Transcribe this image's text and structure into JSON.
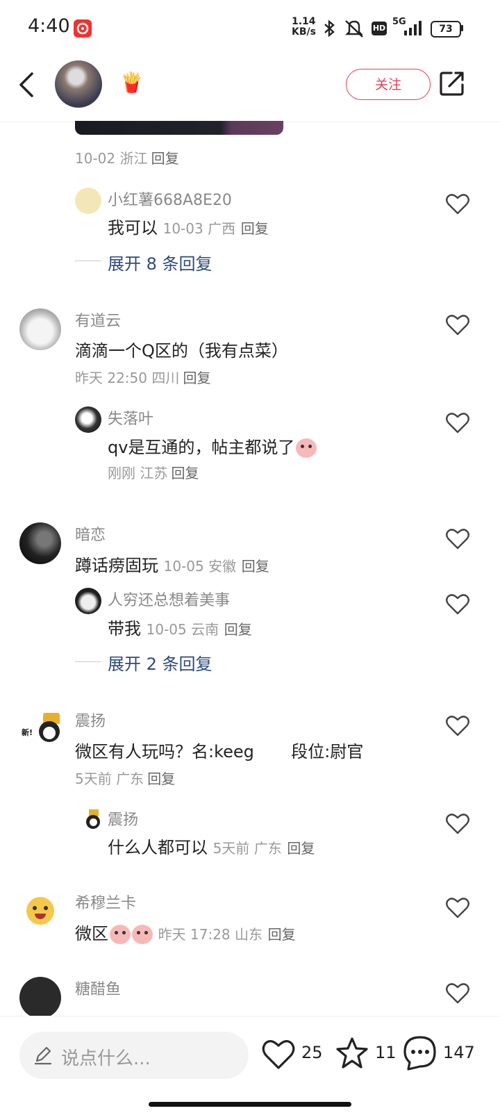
{
  "status_bar": {
    "time": "4:40",
    "network_speed_value": "1.14",
    "network_speed_unit": "KB/s",
    "hd": "HD",
    "network_type": "5G",
    "battery": "73"
  },
  "header": {
    "follow_label": "关注",
    "emoji": "🍟"
  },
  "comments": {
    "c0": {
      "meta": "10-02 浙江",
      "reply": "回复"
    },
    "c0r1": {
      "name": "小红薯668A8E20",
      "text": "我可以",
      "meta": "10-03 广西",
      "reply": "回复"
    },
    "c0_expand": "展开 8 条回复",
    "c1": {
      "name": "有道云",
      "text": "滴滴一个Q区的（我有点菜）",
      "meta": "昨天 22:50 四川",
      "reply": "回复"
    },
    "c1r1": {
      "name": "失落叶",
      "text": "qv是互通的，帖主都说了",
      "meta": "刚刚  江苏",
      "reply": "回复"
    },
    "c2": {
      "name": "暗恋",
      "text": "蹲话痨固玩",
      "meta": "10-05 安徽",
      "reply": "回复"
    },
    "c2r1": {
      "name": "人穷还总想着美事",
      "text": "带我",
      "meta": "10-05 云南",
      "reply": "回复"
    },
    "c2_expand": "展开 2 条回复",
    "c3": {
      "name": "震扬",
      "text": "微区有人玩吗？名:keeg       段位:尉官",
      "meta": "5天前  广东",
      "reply": "回复",
      "avatar_text": "新!"
    },
    "c3r1": {
      "name": "震扬",
      "text": "什么人都可以",
      "meta": "5天前  广东",
      "reply": "回复"
    },
    "c4": {
      "name": "希穆兰卡",
      "text": "微区",
      "meta": "昨天 17:28 山东",
      "reply": "回复"
    },
    "c5": {
      "name": "糖醋鱼"
    }
  },
  "bottom_bar": {
    "placeholder": "说点什么...",
    "likes": "25",
    "favorites": "11",
    "comments": "147"
  },
  "colors": {
    "accent": "#e0405a",
    "link": "#2c4a7c"
  }
}
